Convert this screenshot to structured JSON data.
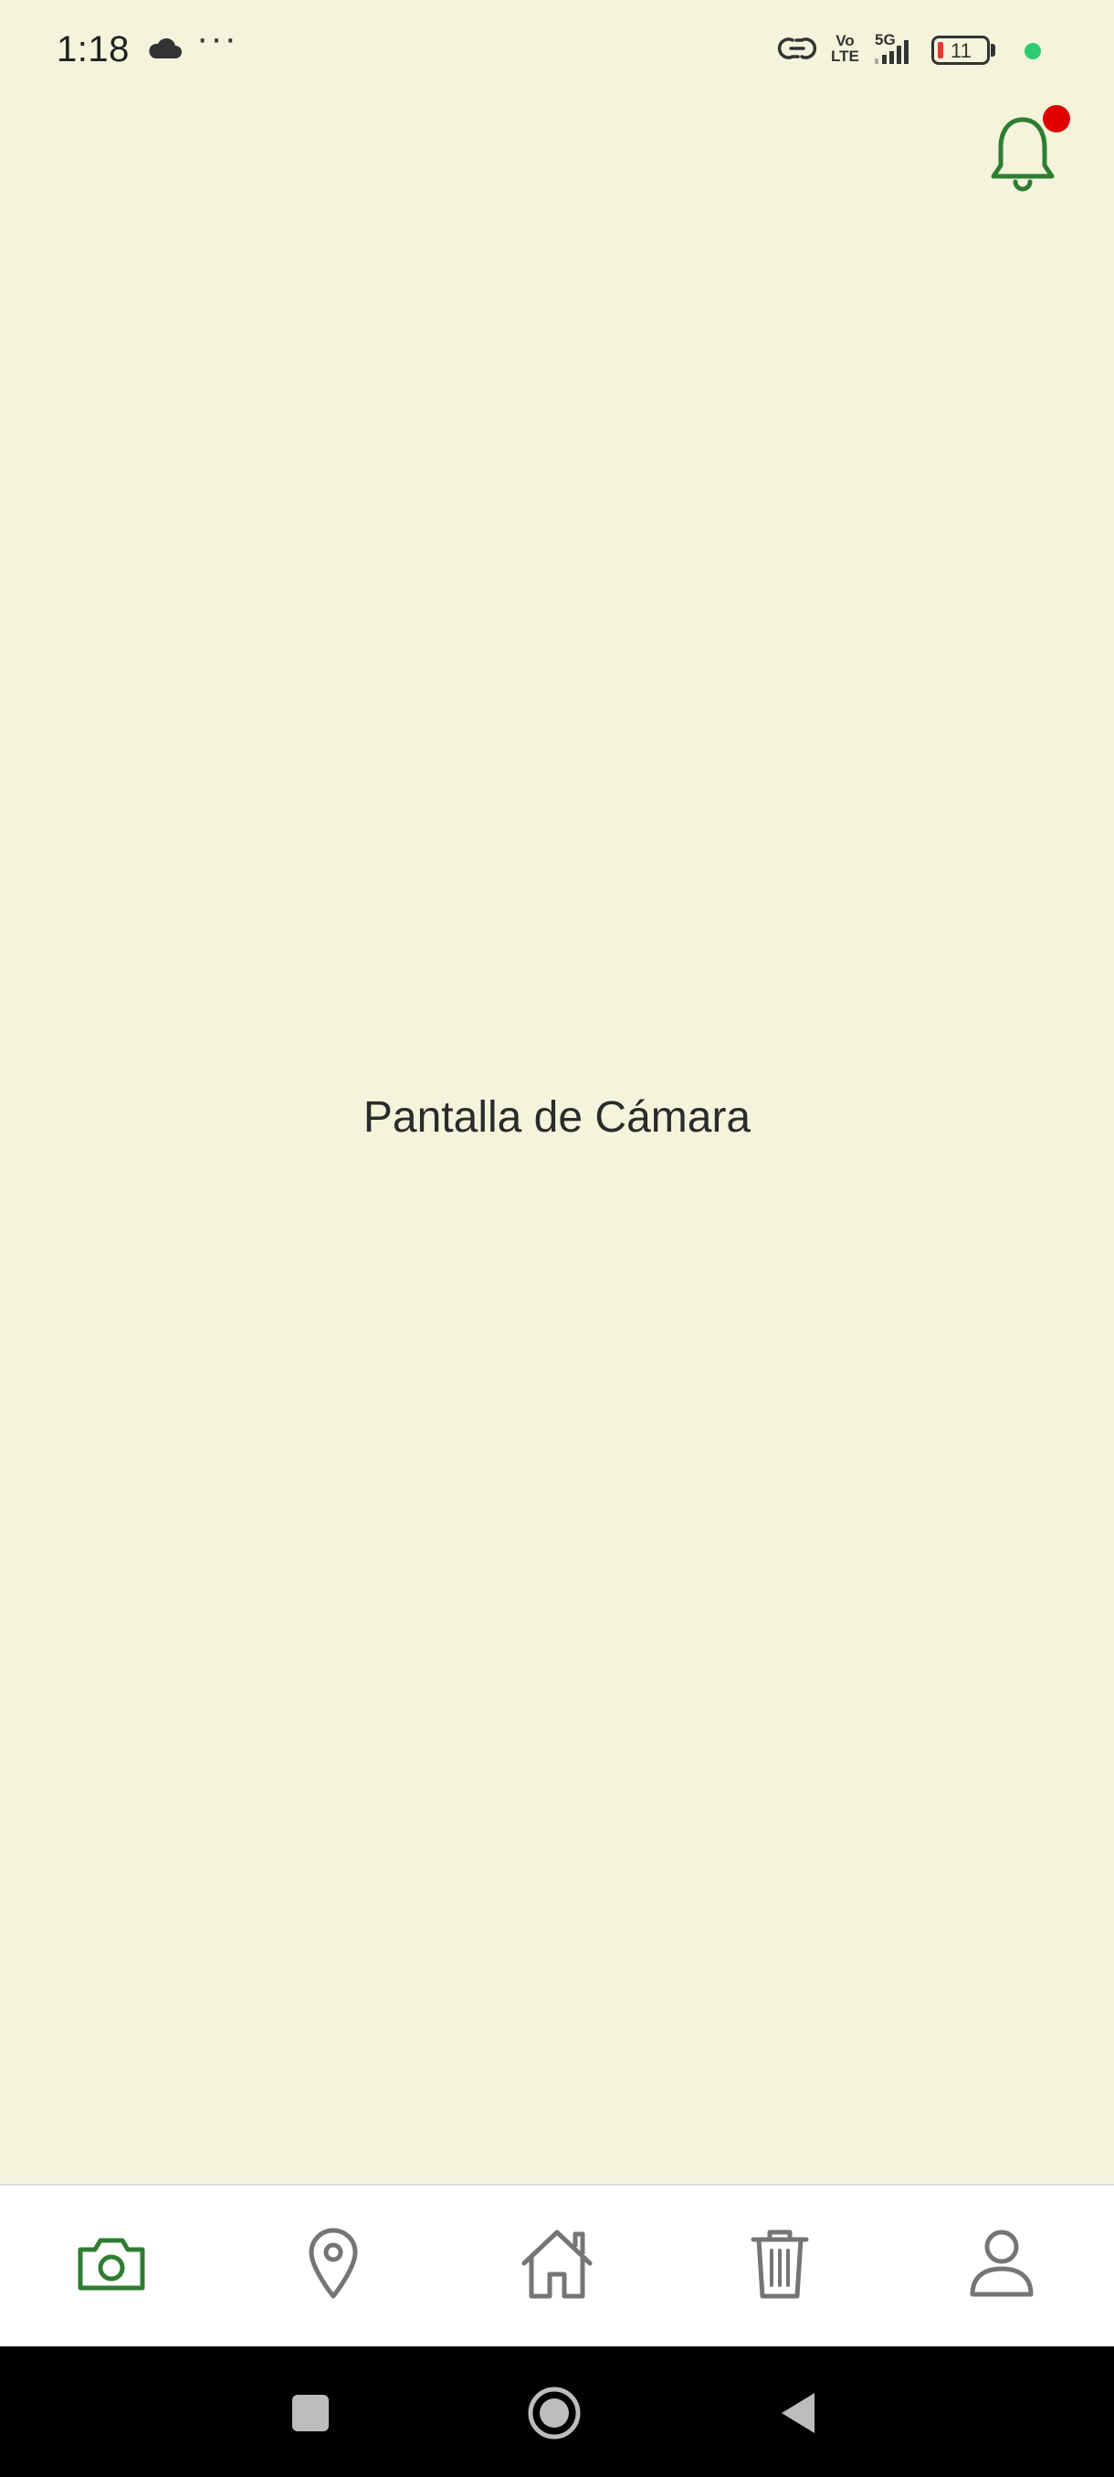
{
  "status_bar": {
    "time": "1:18",
    "more": "···",
    "volte_top": "Vo",
    "volte_bottom": "LTE",
    "network": "5G",
    "battery_level": "11"
  },
  "header": {
    "notification_icon": "bell-icon",
    "has_unread": true
  },
  "main": {
    "title": "Pantalla de Cámara"
  },
  "bottom_nav": {
    "items": [
      {
        "icon": "camera-icon",
        "active": true
      },
      {
        "icon": "location-pin-icon",
        "active": false
      },
      {
        "icon": "home-icon",
        "active": false
      },
      {
        "icon": "trash-icon",
        "active": false
      },
      {
        "icon": "user-icon",
        "active": false
      }
    ]
  },
  "system_nav": {
    "buttons": [
      "recents-icon",
      "home-circle-icon",
      "back-icon"
    ]
  },
  "colors": {
    "background": "#f4f4dc",
    "accent": "#2e7d32",
    "inactive_icon": "#757575",
    "badge": "#e00000"
  }
}
